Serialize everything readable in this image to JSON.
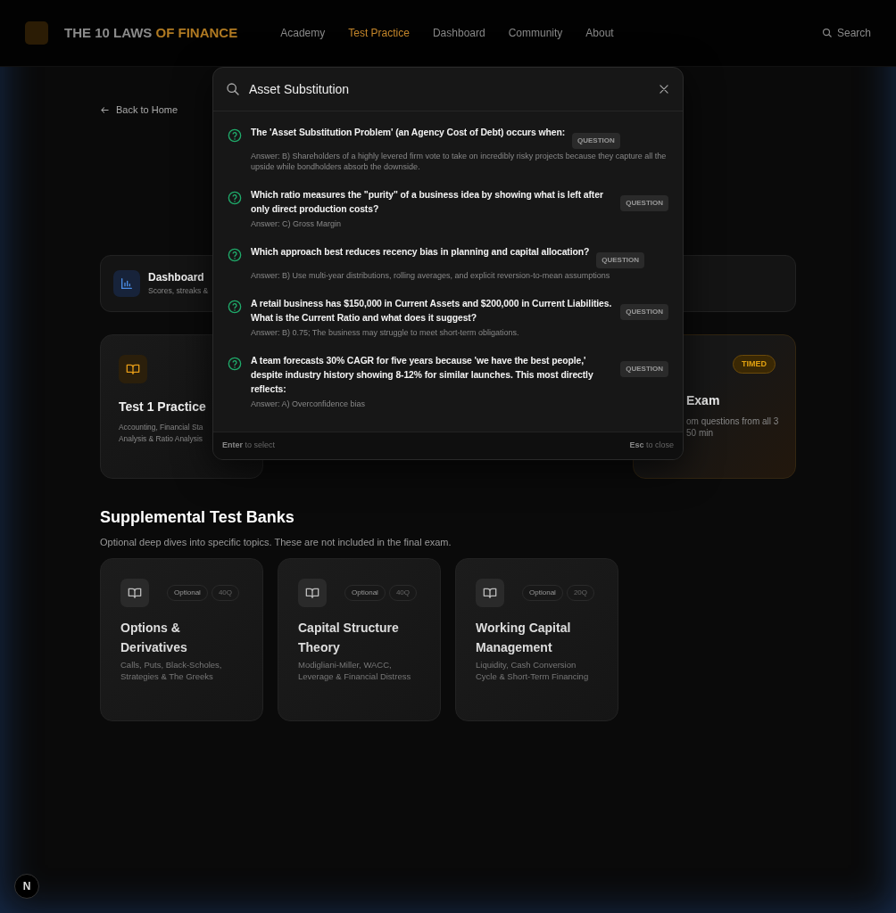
{
  "header": {
    "title": "THE 10 LAWS",
    "title_accent": "OF FINANCE",
    "nav": [
      {
        "label": "Academy",
        "selected": false
      },
      {
        "label": "Test Practice",
        "selected": true
      },
      {
        "label": "Dashboard",
        "selected": false
      },
      {
        "label": "Community",
        "selected": false
      },
      {
        "label": "About",
        "selected": false
      }
    ],
    "search": "Search"
  },
  "back_link": "Back to Home",
  "dashboard_card": {
    "title": "Dashboard",
    "subtitle": "Scores, streaks &"
  },
  "test_cards": [
    {
      "kind": "practice",
      "title": "Test 1 Practice",
      "description_lines": [
        "Accounting, Financial Sta",
        "Analysis & Ratio Analysis"
      ]
    },
    {
      "kind": "exam",
      "badge": "TIMED",
      "title": "Exam",
      "description_lines": [
        "om questions from all 3",
        "50 min"
      ]
    }
  ],
  "supplemental": {
    "heading": "Supplemental Test Banks",
    "subtitle": "Optional deep dives into specific topics. These are not included in the final exam.",
    "cards": [
      {
        "tag": "Optional",
        "count": "40Q",
        "title": "Options & Derivatives",
        "description": "Calls, Puts, Black-Scholes, Strategies & The Greeks"
      },
      {
        "tag": "Optional",
        "count": "40Q",
        "title": "Capital Structure Theory",
        "description": "Modigliani-Miller, WACC, Leverage & Financial Distress"
      },
      {
        "tag": "Optional",
        "count": "20Q",
        "title": "Working Capital Management",
        "description": "Liquidity, Cash Conversion Cycle & Short-Term Financing"
      }
    ]
  },
  "search_dialog": {
    "query": "Asset Substitution",
    "results": [
      {
        "title": "The 'Asset Substitution Problem' (an Agency Cost of Debt) occurs when:",
        "badge": "QUESTION",
        "answer": "Answer: B) Shareholders of a highly levered firm vote to take on incredibly risky projects because they capture all the upside while bondholders absorb the downside."
      },
      {
        "title": "Which ratio measures the \"purity\" of a business idea by showing what is left after only direct production costs?",
        "badge": "QUESTION",
        "answer": "Answer: C) Gross Margin"
      },
      {
        "title": "Which approach best reduces recency bias in planning and capital allocation?",
        "badge": "QUESTION",
        "answer": "Answer: B) Use multi-year distributions, rolling averages, and explicit reversion-to-mean assumptions"
      },
      {
        "title": "A retail business has $150,000 in Current Assets and $200,000 in Current Liabilities. What is the Current Ratio and what does it suggest?",
        "badge": "QUESTION",
        "answer": "Answer: B) 0.75; The business may struggle to meet short-term obligations."
      },
      {
        "title": "A team forecasts 30% CAGR for five years because 'we have the best people,' despite industry history showing 8-12% for similar launches. This most directly reflects:",
        "badge": "QUESTION",
        "answer": "Answer: A) Overconfidence bias"
      }
    ],
    "footer_left": "**Enter** to select",
    "footer_right": "**Esc** to close"
  },
  "dev_badge": "N"
}
